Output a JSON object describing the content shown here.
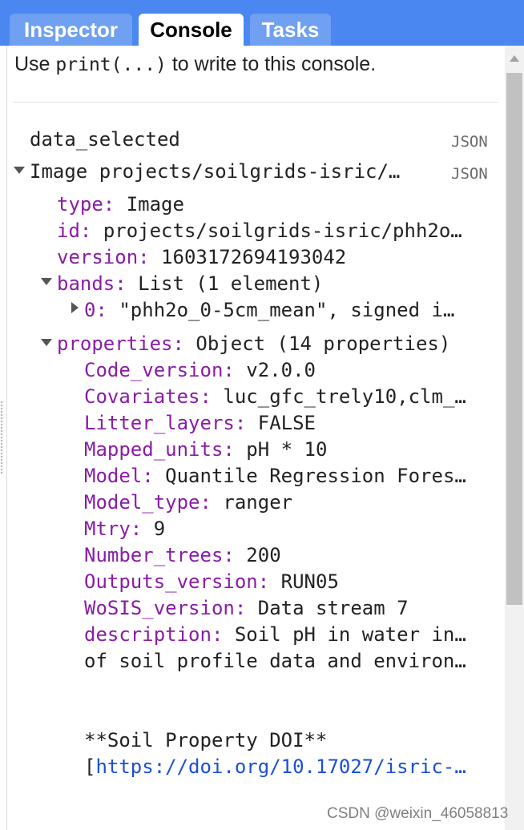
{
  "tabs": [
    {
      "label": "Inspector",
      "active": false
    },
    {
      "label": "Console",
      "active": true
    },
    {
      "label": "Tasks",
      "active": false
    }
  ],
  "console": {
    "hint_prefix": "Use",
    "hint_code": "print(...)",
    "hint_suffix": "to write to this console.",
    "json_label": "JSON",
    "entry_name": "data_selected",
    "image_header": "Image projects/soilgrids-isric/…",
    "image": {
      "type_key": "type:",
      "type_val": "Image",
      "id_key": "id:",
      "id_val": "projects/soilgrids-isric/phh2o…",
      "version_key": "version:",
      "version_val": "1603172694193042",
      "bands_key": "bands:",
      "bands_val": "List (1 element)",
      "band0_key": "0:",
      "band0_val": "\"phh2o_0-5cm_mean\", signed i…",
      "properties_key": "properties:",
      "properties_val": "Object (14 properties)"
    },
    "properties": [
      {
        "key": "Code_version:",
        "value": "v2.0.0"
      },
      {
        "key": "Covariates:",
        "value": "luc_gfc_trely10,clm_…"
      },
      {
        "key": "Litter_layers:",
        "value": "FALSE"
      },
      {
        "key": "Mapped_units:",
        "value": "pH * 10"
      },
      {
        "key": "Model:",
        "value": "Quantile Regression Fores…"
      },
      {
        "key": "Model_type:",
        "value": "ranger"
      },
      {
        "key": "Mtry:",
        "value": "9"
      },
      {
        "key": "Number_trees:",
        "value": "200"
      },
      {
        "key": "Outputs_version:",
        "value": "RUN05"
      },
      {
        "key": "WoSIS_version:",
        "value": "Data stream 7"
      },
      {
        "key": "description:",
        "value": "Soil pH in water in…"
      }
    ],
    "description_cont": "of soil profile data and environ…",
    "doi_heading": "**Soil Property DOI**",
    "doi_bracket": "[",
    "doi_link": "https://doi.org/10.17027/isric-…"
  },
  "watermark": "CSDN @weixin_46058813"
}
